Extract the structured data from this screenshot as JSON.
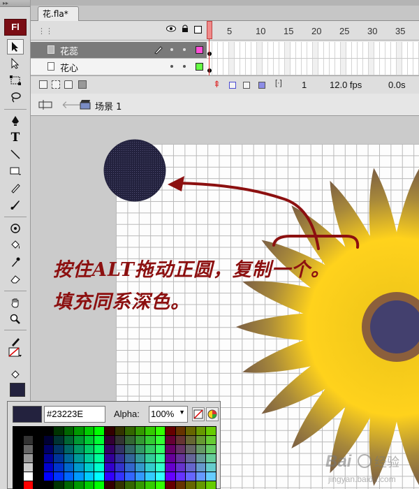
{
  "document": {
    "tab_label": "花.fla*"
  },
  "tools": {
    "logo": "Fl",
    "items": [
      "selection-tool",
      "subselection-tool",
      "free-transform-tool",
      "lasso-tool",
      "pen-tool",
      "text-tool",
      "line-tool",
      "rectangle-tool",
      "pencil-tool",
      "brush-tool",
      "deco-tool",
      "paint-bucket-tool",
      "eyedropper-tool",
      "eraser-tool",
      "hand-tool",
      "zoom-tool"
    ],
    "text_tool_glyph": "T"
  },
  "timeline": {
    "frame_numbers": [
      "5",
      "10",
      "15",
      "20",
      "25",
      "30",
      "35"
    ],
    "layers": [
      {
        "name": "花蕊",
        "active": true,
        "color": "#ff4fd6"
      },
      {
        "name": "花心",
        "active": false,
        "color": "#66ff44"
      }
    ],
    "current_frame": "1",
    "fps": "12.0 fps",
    "time": "0.0s"
  },
  "editbar": {
    "scene": "场景 1"
  },
  "stage": {
    "annotation_line1": "按住ALT拖动正圆，复制一个。",
    "annotation_line2": "填充同系深色。",
    "circle_fill": "#23223e",
    "annotation_color": "#8c1010"
  },
  "color_popup": {
    "hex_value": "#23223E",
    "alpha_label": "Alpha:",
    "alpha_value": "100%"
  }
}
